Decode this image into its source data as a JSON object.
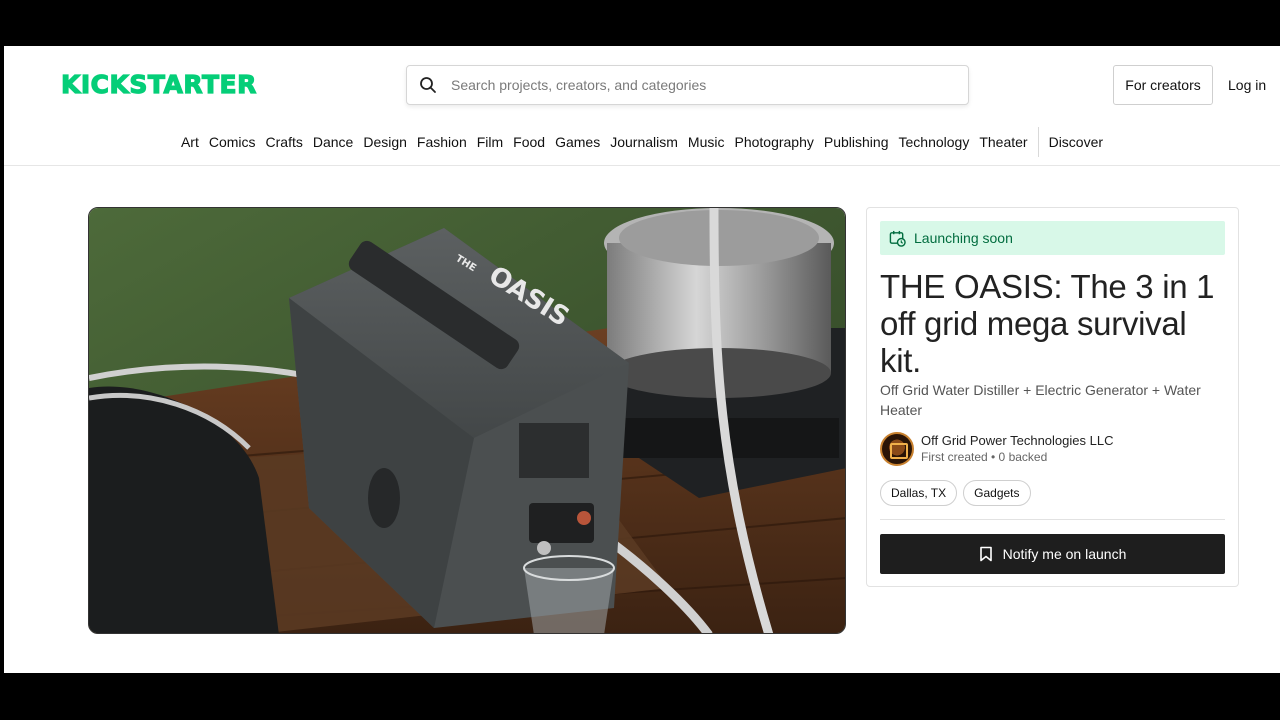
{
  "header": {
    "logo_text": "KICKSTARTER",
    "search_placeholder": "Search projects, creators, and categories",
    "for_creators_label": "For creators",
    "login_label": "Log in"
  },
  "categories": [
    "Art",
    "Comics",
    "Crafts",
    "Dance",
    "Design",
    "Fashion",
    "Film",
    "Food",
    "Games",
    "Journalism",
    "Music",
    "Photography",
    "Publishing",
    "Technology",
    "Theater"
  ],
  "discover_label": "Discover",
  "project": {
    "status": "Launching soon",
    "title": "THE OASIS: The 3 in 1 off grid mega survival kit.",
    "subtitle": "Off Grid Water Distiller + Electric Generator + Water Heater",
    "creator_name": "Off Grid Power Technologies LLC",
    "creator_meta": "First created • 0 backed",
    "tags": [
      "Dallas, TX",
      "Gadgets"
    ],
    "notify_label": "Notify me on launch",
    "hero_box_label": "OASIS",
    "hero_box_small": "THE"
  },
  "colors": {
    "brand": "#05ce78",
    "badge_bg": "#d8f8e8",
    "badge_text": "#026d3f",
    "button_bg": "#1e1e1e"
  }
}
